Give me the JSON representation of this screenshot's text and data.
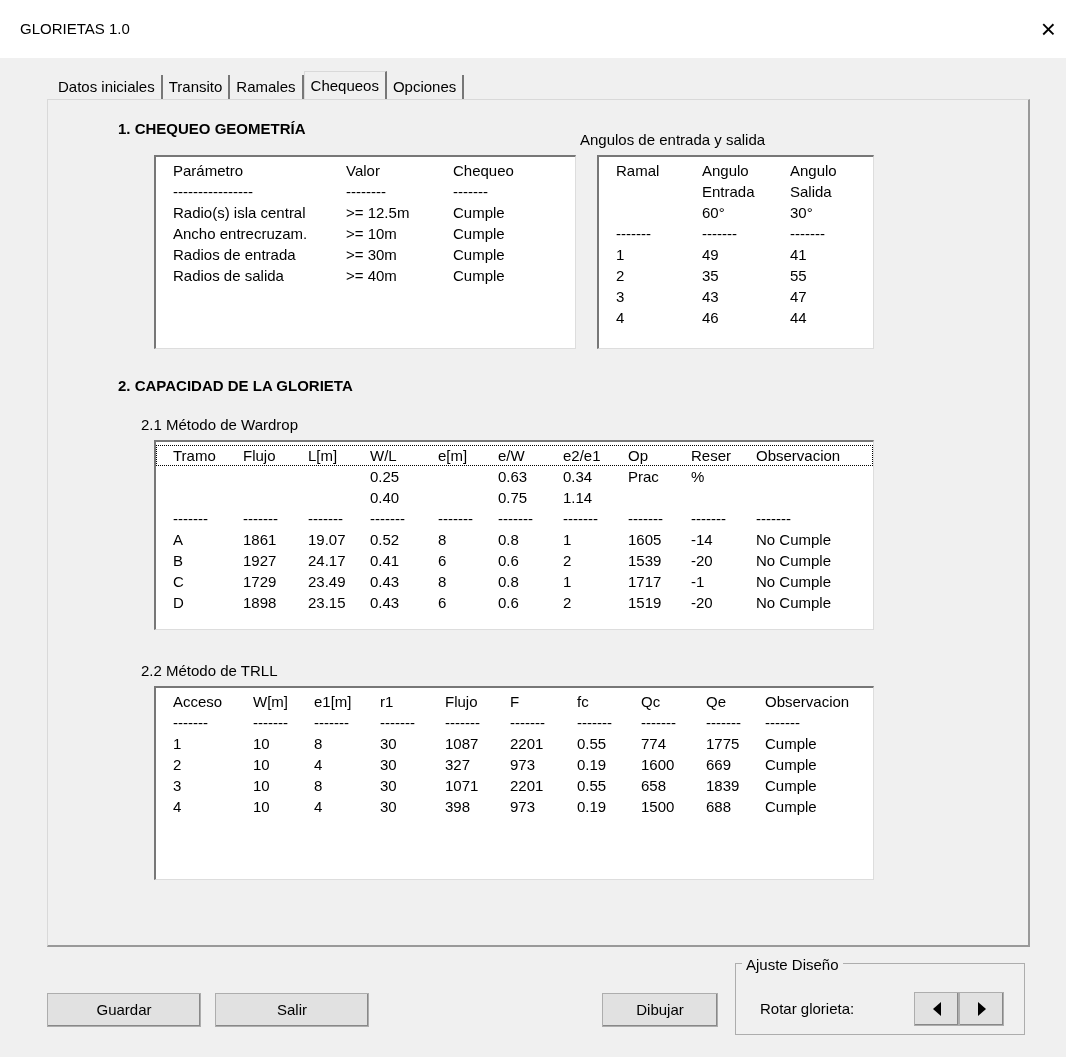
{
  "window": {
    "title": "GLORIETAS 1.0",
    "close": "×"
  },
  "tabs": [
    {
      "label": "Datos iniciales",
      "selected": false
    },
    {
      "label": "Transito",
      "selected": false
    },
    {
      "label": "Ramales",
      "selected": false
    },
    {
      "label": "Chequeos",
      "selected": true
    },
    {
      "label": "Opciones",
      "selected": false
    }
  ],
  "geometry": {
    "title": "1. CHEQUEO GEOMETRÍA",
    "checks": {
      "rows": [
        {
          "cells": [
            "Parámetro",
            "Valor",
            "Chequeo"
          ]
        },
        {
          "cells": [
            "----------------",
            "--------",
            "-------"
          ]
        },
        {
          "cells": [
            "Radio(s) isla central",
            ">= 12.5m",
            "Cumple"
          ]
        },
        {
          "cells": [
            "Ancho entrecruzam.",
            ">= 10m",
            "Cumple"
          ]
        },
        {
          "cells": [
            "Radios de entrada",
            ">= 30m",
            "Cumple"
          ]
        },
        {
          "cells": [
            "Radios de salida",
            ">= 40m",
            "Cumple"
          ]
        }
      ]
    },
    "angles": {
      "label": "Angulos de entrada y salida",
      "rows": [
        {
          "cells": [
            "Ramal",
            "Angulo\nEntrada\n60°",
            "Angulo\nSalida\n30°"
          ]
        },
        {
          "cells": [
            "-------",
            "-------",
            "-------"
          ]
        },
        {
          "cells": [
            "1",
            "49",
            "41"
          ]
        },
        {
          "cells": [
            "2",
            "35",
            "55"
          ]
        },
        {
          "cells": [
            "3",
            "43",
            "47"
          ]
        },
        {
          "cells": [
            "4",
            "46",
            "44"
          ]
        }
      ]
    }
  },
  "capacity": {
    "title": "2. CAPACIDAD DE LA GLORIETA",
    "wardrop": {
      "label": "2.1 Método de Wardrop",
      "rows": [
        {
          "focused": true,
          "cells": [
            "Tramo",
            "Flujo",
            "L[m]",
            "W/L",
            "e[m]",
            "e/W",
            "e2/e1",
            "Op",
            "Reser",
            "Observacion"
          ]
        },
        {
          "focused": false,
          "cells": [
            null,
            null,
            null,
            "0.25",
            null,
            "0.63",
            "0.34",
            "Prac",
            "%",
            null
          ]
        },
        {
          "focused": false,
          "cells": [
            null,
            null,
            null,
            "0.40",
            null,
            "0.75",
            "1.14",
            null,
            null,
            null
          ]
        },
        {
          "focused": false,
          "cells": [
            "-------",
            "-------",
            "-------",
            "-------",
            "-------",
            "-------",
            "-------",
            "-------",
            "-------",
            "-------"
          ]
        },
        {
          "focused": false,
          "cells": [
            "A",
            "1861",
            "19.07",
            "0.52",
            "8",
            "0.8",
            "1",
            "1605",
            "-14",
            "No Cumple"
          ]
        },
        {
          "focused": false,
          "cells": [
            "B",
            "1927",
            "24.17",
            "0.41",
            "6",
            "0.6",
            "2",
            "1539",
            "-20",
            "No Cumple"
          ]
        },
        {
          "focused": false,
          "cells": [
            "C",
            "1729",
            "23.49",
            "0.43",
            "8",
            "0.8",
            "1",
            "1717",
            "-1",
            "No Cumple"
          ]
        },
        {
          "focused": false,
          "cells": [
            "D",
            "1898",
            "23.15",
            "0.43",
            "6",
            "0.6",
            "2",
            "1519",
            "-20",
            "No Cumple"
          ]
        }
      ]
    },
    "trll": {
      "label": "2.2 Método de TRLL",
      "rows": [
        {
          "cells": [
            "Acceso",
            "W[m]",
            "e1[m]",
            "r1",
            "Flujo",
            "F",
            "fc",
            "Qc",
            "Qe",
            "Observacion"
          ]
        },
        {
          "cells": [
            "-------",
            "-------",
            "-------",
            "-------",
            "-------",
            "-------",
            "-------",
            "-------",
            "-------",
            "-------"
          ]
        },
        {
          "cells": [
            "1",
            "10",
            "8",
            "30",
            "1087",
            "2201",
            "0.55",
            "774",
            "1775",
            "Cumple"
          ]
        },
        {
          "cells": [
            "2",
            "10",
            "4",
            "30",
            "327",
            "973",
            "0.19",
            "1600",
            "669",
            "Cumple"
          ]
        },
        {
          "cells": [
            "3",
            "10",
            "8",
            "30",
            "1071",
            "2201",
            "0.55",
            "658",
            "1839",
            "Cumple"
          ]
        },
        {
          "cells": [
            "4",
            "10",
            "4",
            "30",
            "398",
            "973",
            "0.19",
            "1500",
            "688",
            "Cumple"
          ]
        }
      ]
    }
  },
  "buttons": [
    "Guardar",
    "Salir",
    "Dibujar"
  ],
  "design": {
    "legend": "Ajuste Diseño",
    "label": "Rotar glorieta:"
  }
}
